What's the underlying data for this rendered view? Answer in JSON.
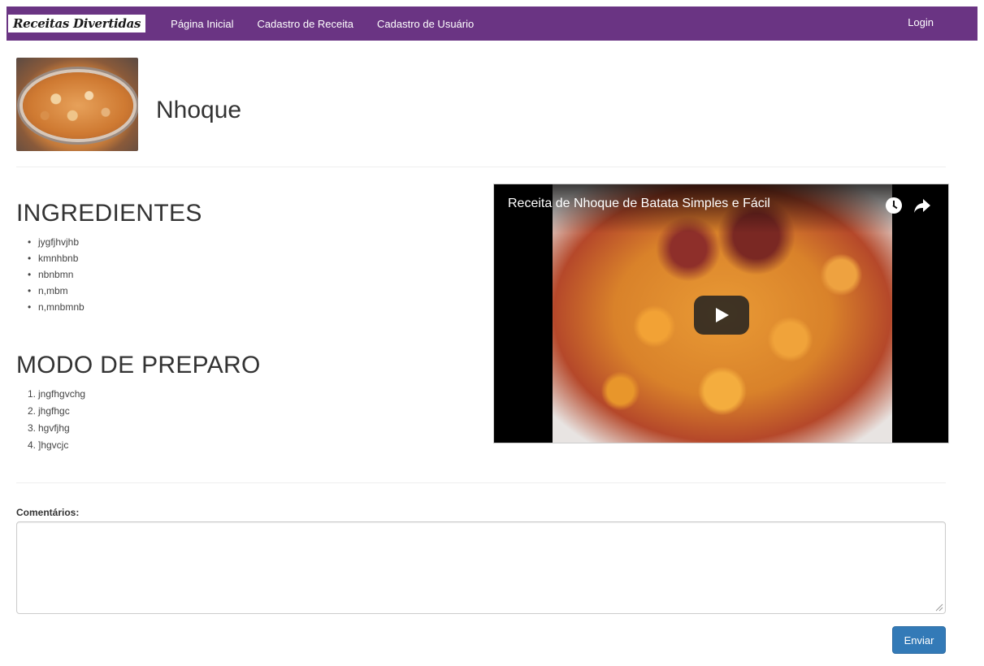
{
  "navbar": {
    "brand": "Receitas Divertidas",
    "links": [
      "Página Inicial",
      "Cadastro de Receita",
      "Cadastro de Usuário"
    ],
    "login": "Login",
    "color": "#6a3483"
  },
  "recipe": {
    "title": "Nhoque"
  },
  "ingredients": {
    "title": "INGREDIENTES",
    "items": [
      "jygfjhvjhb",
      "kmnhbnb",
      "nbnbmn",
      "n,mbm",
      "n,mnbmnb"
    ]
  },
  "preparation": {
    "title": "MODO DE PREPARO",
    "steps": [
      "jngfhgvchg",
      "jhgfhgc",
      "hgvfjhg",
      "]hgvcjc"
    ]
  },
  "video": {
    "title": "Receita de Nhoque de Batata Simples e Fácil"
  },
  "comments": {
    "label": "Comentários:",
    "value": "",
    "placeholder": "",
    "submit_label": "Enviar",
    "submit_color": "#337ab7"
  }
}
